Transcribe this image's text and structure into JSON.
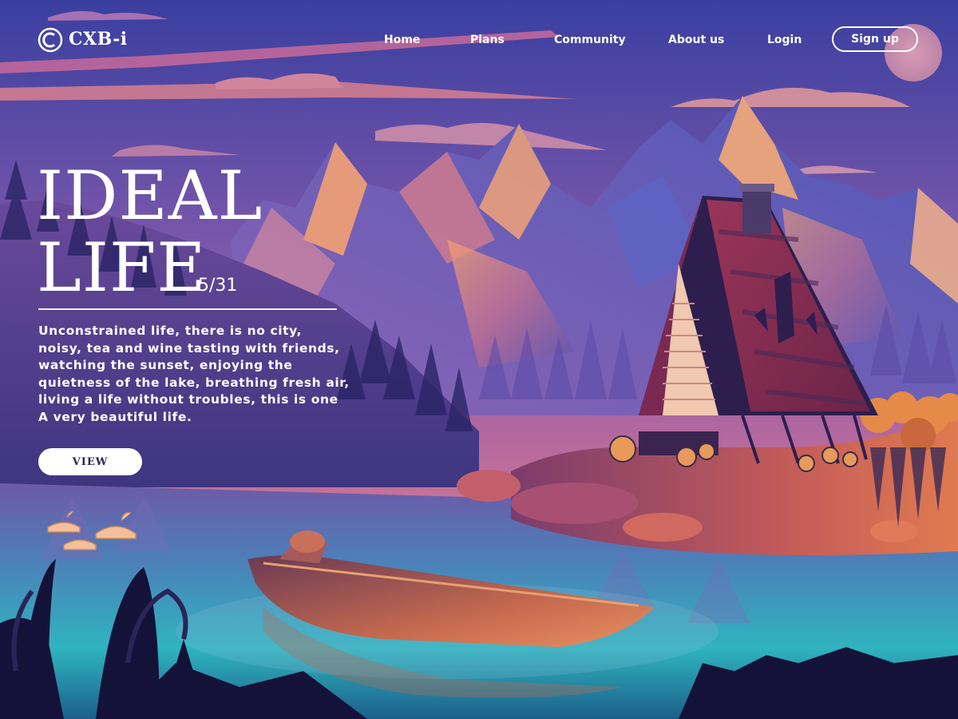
{
  "brand": {
    "name": "CXB-i",
    "logo_icon": "c-circle-logo-icon"
  },
  "nav": {
    "items": [
      {
        "label": "Home"
      },
      {
        "label": "Plans"
      },
      {
        "label": "Community"
      },
      {
        "label": "About us"
      },
      {
        "label": "Login"
      }
    ],
    "signup_label": "Sign up"
  },
  "hero": {
    "title_line1": "IDEAL",
    "title_line2": "LIFE",
    "page_counter": "5/31",
    "description": "Unconstrained life, there is no city, noisy, tea and wine tasting with friends, watching the sunset, enjoying the quietness of the lake, breathing fresh air, living a life without troubles, this is one A very beautiful life.",
    "cta_label": "VIEW"
  },
  "colors": {
    "sky_top": "#3b3a9c",
    "sky_mid": "#8a5aa8",
    "sky_horizon": "#e88e7a",
    "mountain_light": "#f29a6e",
    "mountain_shadow": "#4a4fb0",
    "lake": "#2fb4c0",
    "cabin_roof": "#8a2d4f",
    "text": "#ffffff",
    "button_text": "#2b2652"
  }
}
